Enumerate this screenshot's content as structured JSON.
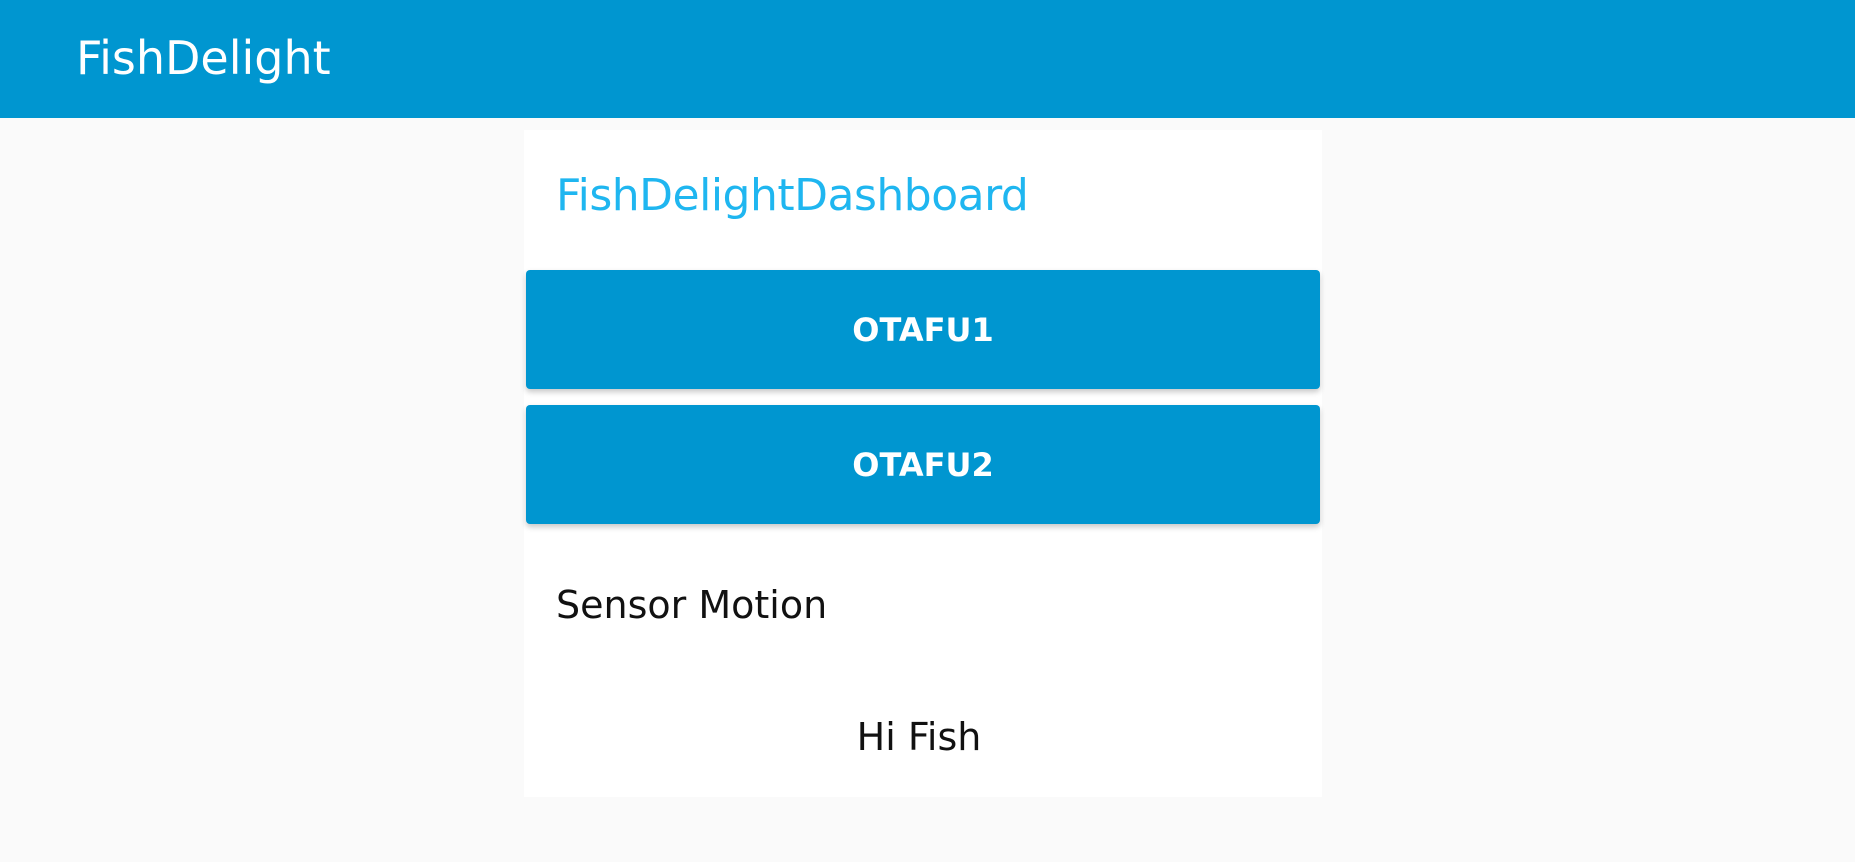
{
  "header": {
    "title": "FishDelight"
  },
  "dashboard": {
    "group_title": "FishDelightDashboard",
    "buttons": [
      {
        "label": "OTAFU1"
      },
      {
        "label": "OTAFU2"
      }
    ],
    "sensor": {
      "label": "Sensor Motion",
      "value": "Hi Fish"
    }
  },
  "colors": {
    "accent": "#0096d0",
    "group_title": "#1fb6f0",
    "background": "#fafafa",
    "card": "#ffffff"
  }
}
